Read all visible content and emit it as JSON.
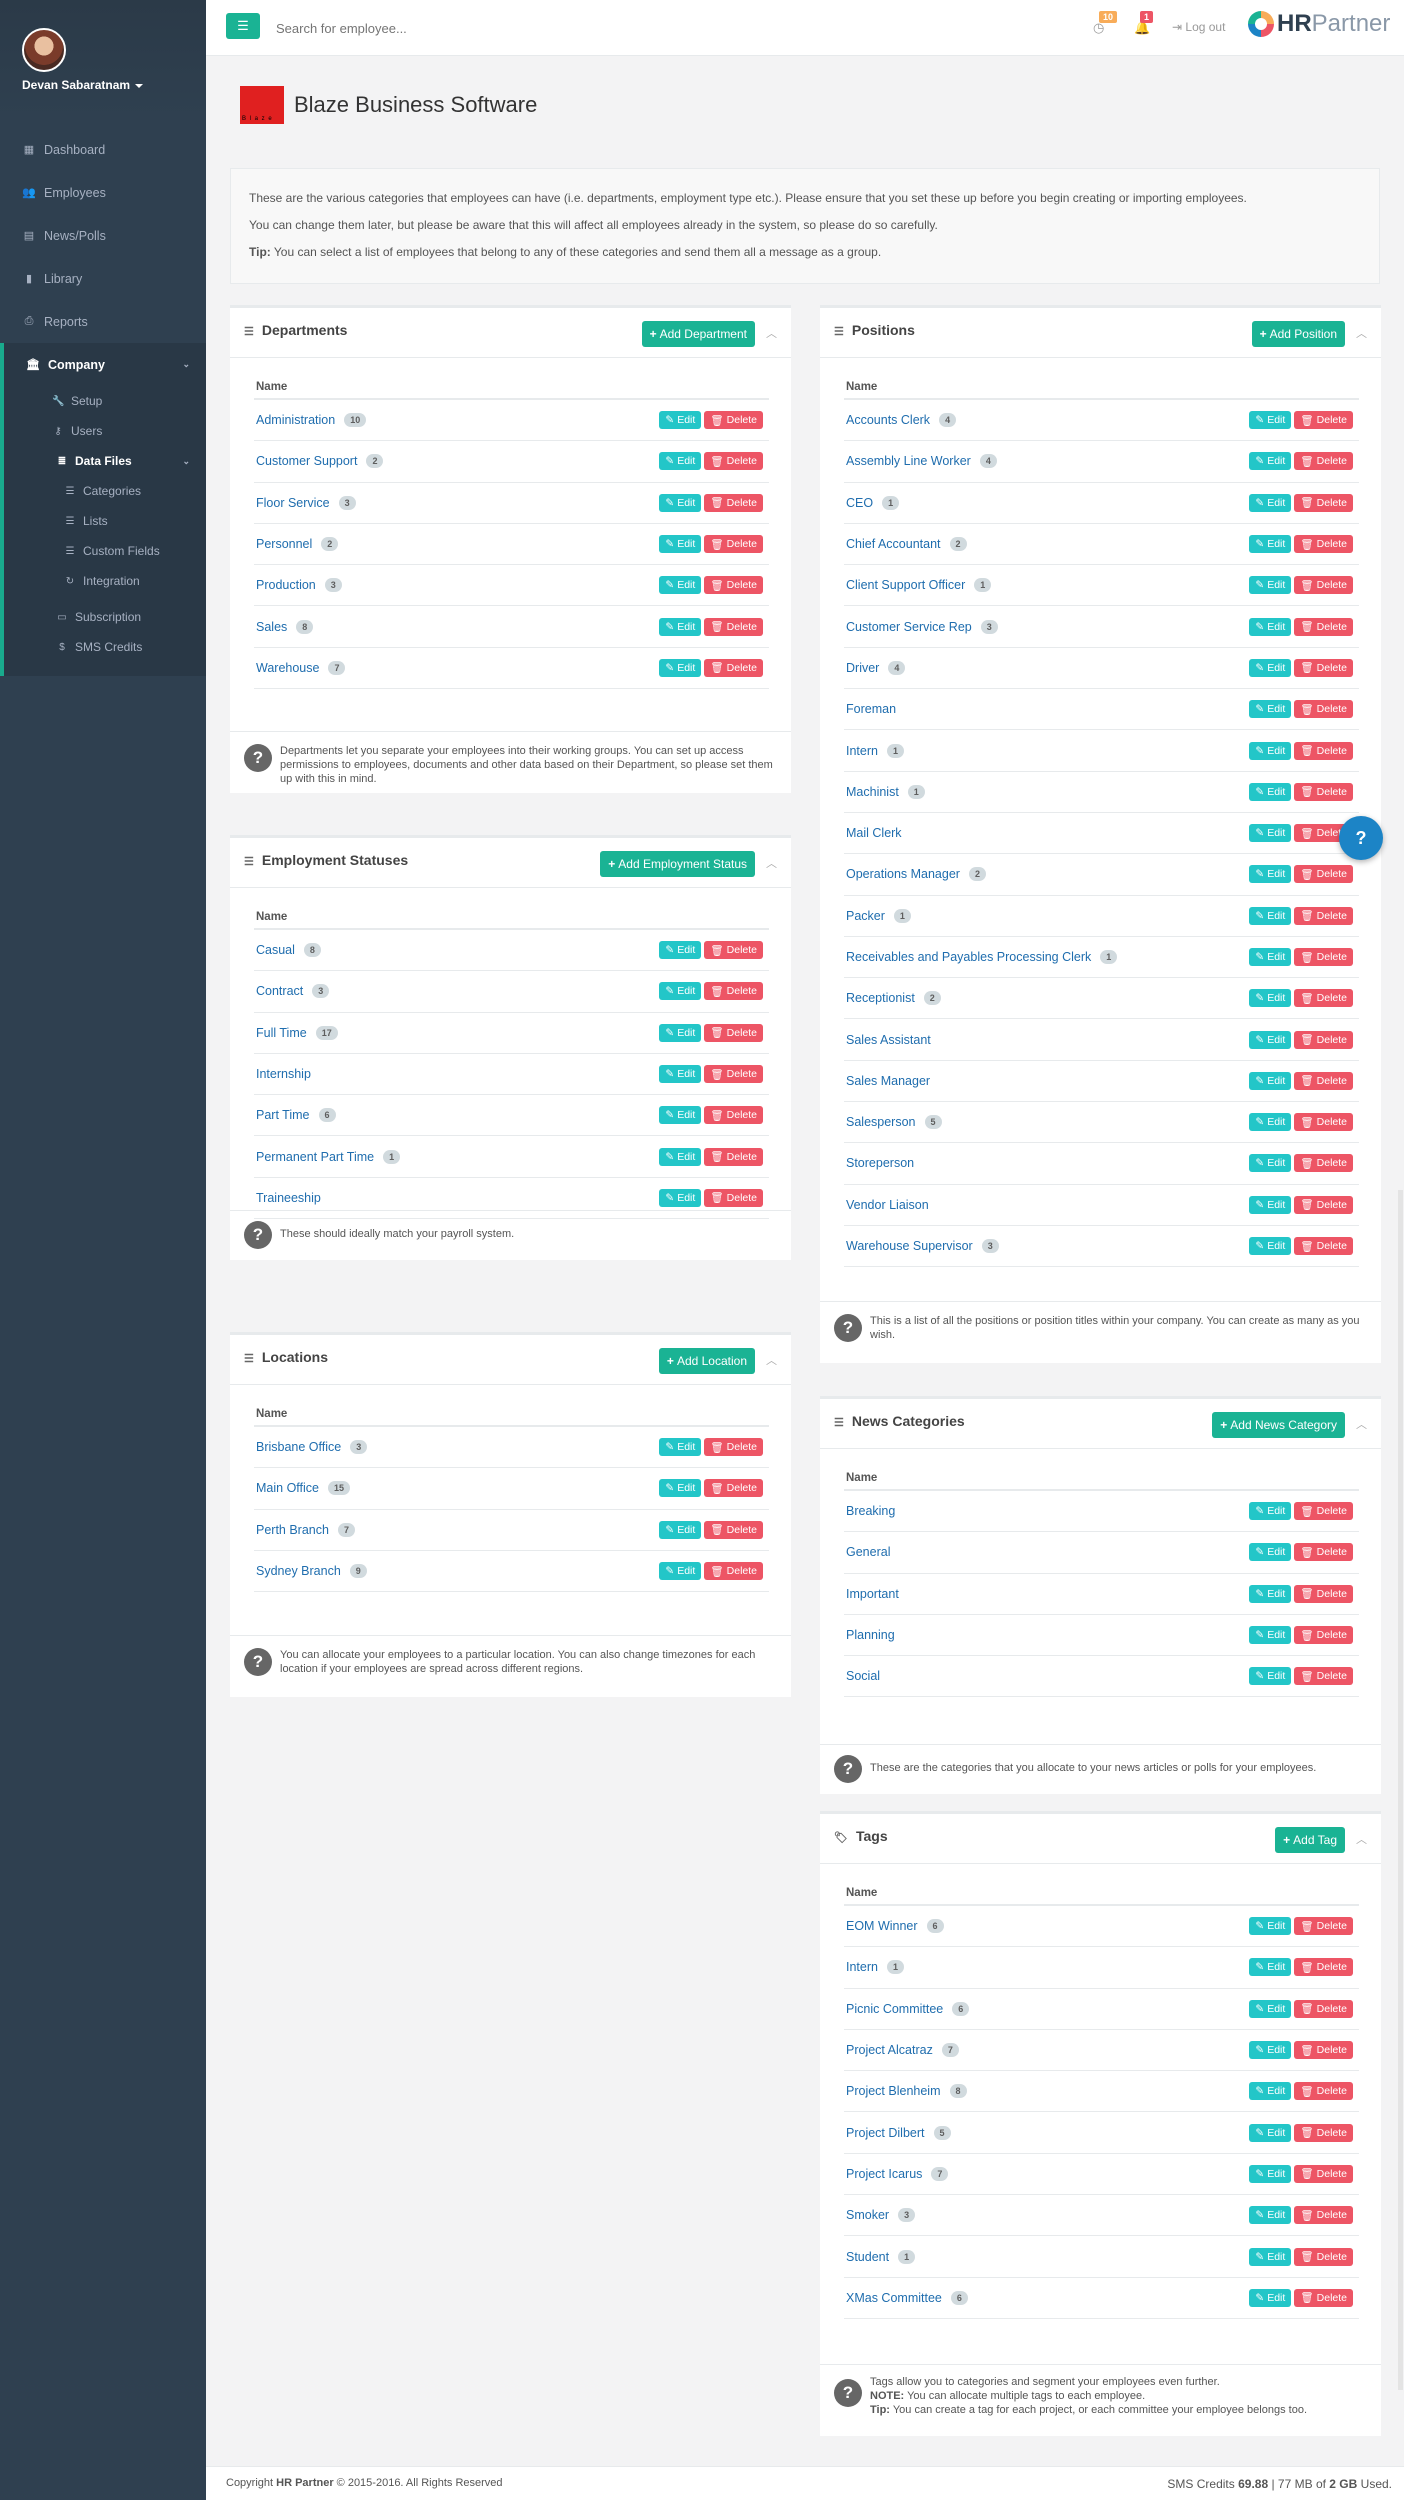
{
  "user": {
    "name": "Devan Sabaratnam"
  },
  "nav": [
    {
      "label": "Dashboard",
      "icon": "dashboard-icon"
    },
    {
      "label": "Employees",
      "icon": "users-icon"
    },
    {
      "label": "News/Polls",
      "icon": "newspaper-icon"
    },
    {
      "label": "Library",
      "icon": "book-icon"
    },
    {
      "label": "Reports",
      "icon": "print-icon"
    }
  ],
  "company_nav": {
    "label": "Company",
    "items": [
      "Setup",
      "Users",
      "Data Files"
    ],
    "data_files": [
      "Categories",
      "Lists",
      "Custom Fields",
      "Integration"
    ],
    "extra": [
      "Subscription",
      "SMS Credits"
    ]
  },
  "topbar": {
    "search_placeholder": "Search for employee...",
    "timer_badge": "10",
    "bell_badge": "1",
    "logout": "Log out",
    "logo_hr": "HR",
    "logo_partner": "Partner"
  },
  "company": {
    "name": "Blaze Business Software",
    "logo_text": "B l a z e"
  },
  "info": {
    "line1": "These are the various categories that employees can have (i.e. departments, employment type etc.). Please ensure that you set these up before you begin creating or importing employees.",
    "line2": "You can change them later, but please be aware that this will affect all employees already in the system, so please do so carefully.",
    "tip_label": "Tip:",
    "tip": " You can select a list of employees that belong to any of these categories and send them all a message as a group."
  },
  "labels": {
    "name": "Name",
    "edit": "Edit",
    "delete": "Delete"
  },
  "departments": {
    "title": "Departments",
    "add": "Add Department",
    "rows": [
      {
        "name": "Administration",
        "count": "10"
      },
      {
        "name": "Customer Support",
        "count": "2"
      },
      {
        "name": "Floor Service",
        "count": "3"
      },
      {
        "name": "Personnel",
        "count": "2"
      },
      {
        "name": "Production",
        "count": "3"
      },
      {
        "name": "Sales",
        "count": "8"
      },
      {
        "name": "Warehouse",
        "count": "7"
      }
    ],
    "help": "Departments let you separate your employees into their working groups. You can set up access permissions to employees, documents and other data based on their Department, so please set them up with this in mind."
  },
  "statuses": {
    "title": "Employment Statuses",
    "add": "Add Employment Status",
    "rows": [
      {
        "name": "Casual",
        "count": "8"
      },
      {
        "name": "Contract",
        "count": "3"
      },
      {
        "name": "Full Time",
        "count": "17"
      },
      {
        "name": "Internship",
        "count": ""
      },
      {
        "name": "Part Time",
        "count": "6"
      },
      {
        "name": "Permanent Part Time",
        "count": "1"
      },
      {
        "name": "Traineeship",
        "count": ""
      }
    ],
    "help": "These should ideally match your payroll system."
  },
  "locations": {
    "title": "Locations",
    "add": "Add Location",
    "rows": [
      {
        "name": "Brisbane Office",
        "count": "3"
      },
      {
        "name": "Main Office",
        "count": "15"
      },
      {
        "name": "Perth Branch",
        "count": "7"
      },
      {
        "name": "Sydney Branch",
        "count": "9"
      }
    ],
    "help": "You can allocate your employees to a particular location. You can also change timezones for each location if your employees are spread across different regions."
  },
  "positions": {
    "title": "Positions",
    "add": "Add Position",
    "rows": [
      {
        "name": "Accounts Clerk",
        "count": "4"
      },
      {
        "name": "Assembly Line Worker",
        "count": "4"
      },
      {
        "name": "CEO",
        "count": "1"
      },
      {
        "name": "Chief Accountant",
        "count": "2"
      },
      {
        "name": "Client Support Officer",
        "count": "1"
      },
      {
        "name": "Customer Service Rep",
        "count": "3"
      },
      {
        "name": "Driver",
        "count": "4"
      },
      {
        "name": "Foreman",
        "count": ""
      },
      {
        "name": "Intern",
        "count": "1"
      },
      {
        "name": "Machinist",
        "count": "1"
      },
      {
        "name": "Mail Clerk",
        "count": ""
      },
      {
        "name": "Operations Manager",
        "count": "2"
      },
      {
        "name": "Packer",
        "count": "1"
      },
      {
        "name": "Receivables and Payables Processing Clerk",
        "count": "1"
      },
      {
        "name": "Receptionist",
        "count": "2"
      },
      {
        "name": "Sales Assistant",
        "count": ""
      },
      {
        "name": "Sales Manager",
        "count": ""
      },
      {
        "name": "Salesperson",
        "count": "5"
      },
      {
        "name": "Storeperson",
        "count": ""
      },
      {
        "name": "Vendor Liaison",
        "count": ""
      },
      {
        "name": "Warehouse Supervisor",
        "count": "3"
      }
    ],
    "help": "This is a list of all the positions or position titles within your company. You can create as many as you wish."
  },
  "news": {
    "title": "News Categories",
    "add": "Add News Category",
    "rows": [
      {
        "name": "Breaking",
        "count": ""
      },
      {
        "name": "General",
        "count": ""
      },
      {
        "name": "Important",
        "count": ""
      },
      {
        "name": "Planning",
        "count": ""
      },
      {
        "name": "Social",
        "count": ""
      }
    ],
    "help": "These are the categories that you allocate to your news articles or polls for your employees."
  },
  "tags": {
    "title": "Tags",
    "add": "Add Tag",
    "rows": [
      {
        "name": "EOM Winner",
        "count": "6"
      },
      {
        "name": "Intern",
        "count": "1"
      },
      {
        "name": "Picnic Committee",
        "count": "6"
      },
      {
        "name": "Project Alcatraz",
        "count": "7"
      },
      {
        "name": "Project Blenheim",
        "count": "8"
      },
      {
        "name": "Project Dilbert",
        "count": "5"
      },
      {
        "name": "Project Icarus",
        "count": "7"
      },
      {
        "name": "Smoker",
        "count": "3"
      },
      {
        "name": "Student",
        "count": "1"
      },
      {
        "name": "XMas Committee",
        "count": "6"
      }
    ],
    "help1": "Tags allow you to categories and segment your employees even further.",
    "note_label": "NOTE:",
    "note": " You can allocate multiple tags to each employee.",
    "tip_label": "Tip:",
    "tip": " You can create a tag for each project, or each committee your employee belongs too."
  },
  "footer": {
    "copy_pre": "Copyright ",
    "copy_brand": "HR Partner",
    "copy_post": " © 2015-2016. All Rights Reserved",
    "sms_label": "SMS Credits ",
    "sms_value": "69.88",
    "storage_pre": " | 77 MB of ",
    "storage_total": "2 GB",
    "storage_post": " Used."
  },
  "colors": {
    "accent": "#1ab394",
    "edit": "#23c6c8",
    "delete": "#ed5565",
    "sidebar": "#2f4050"
  }
}
